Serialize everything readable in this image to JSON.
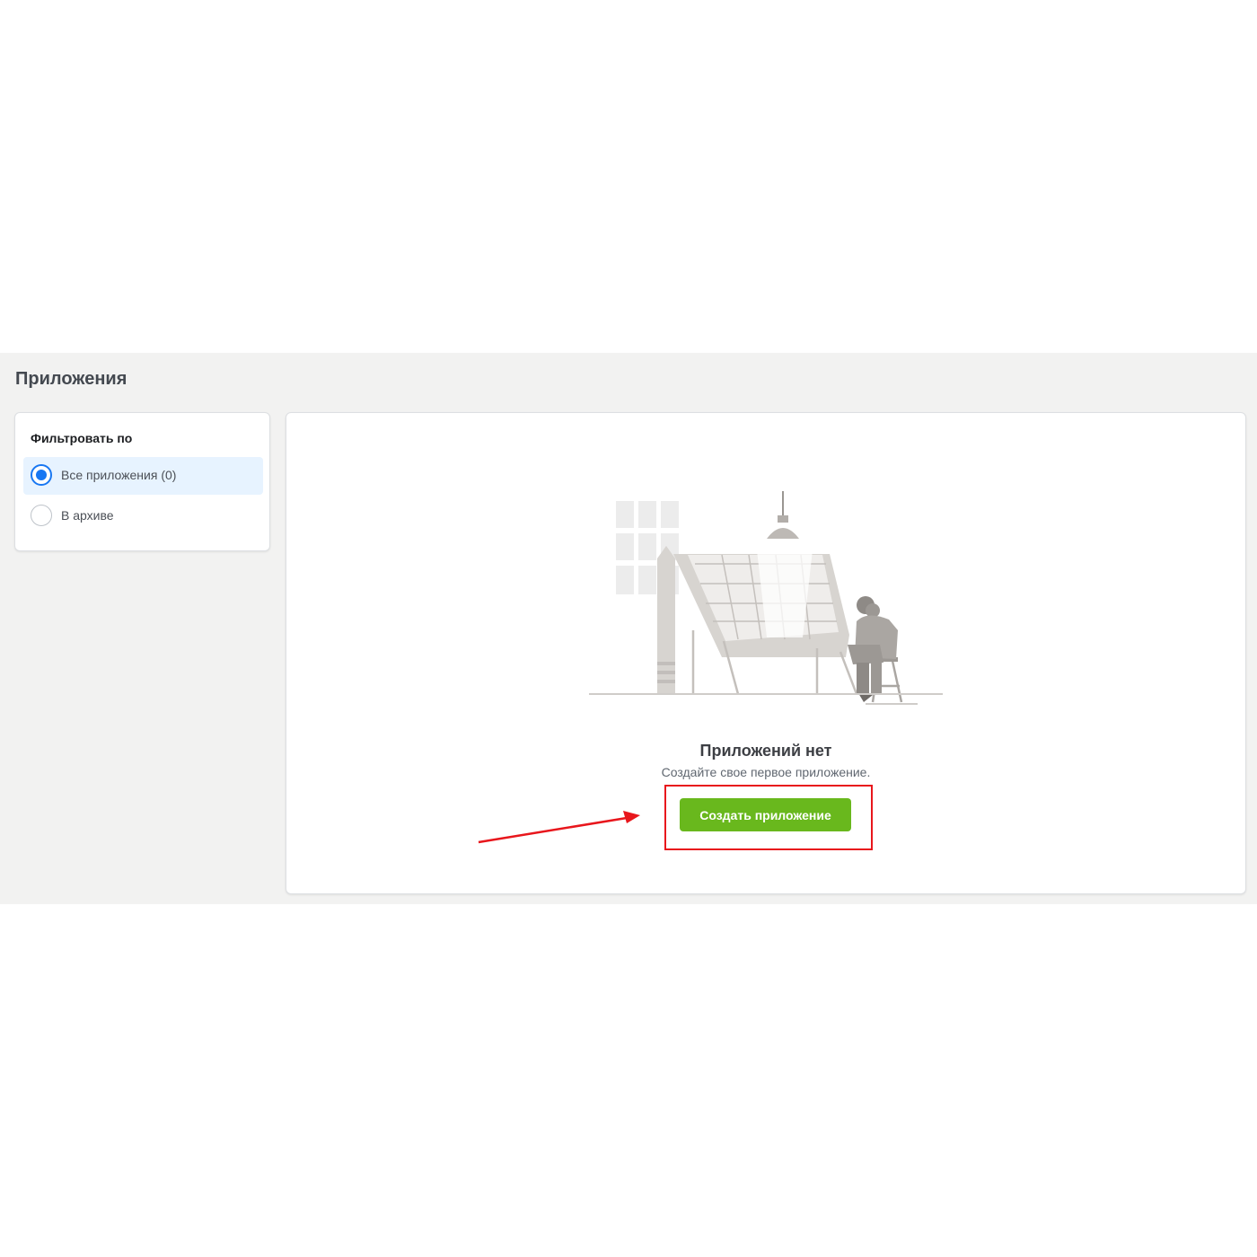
{
  "page": {
    "title": "Приложения"
  },
  "filter": {
    "heading": "Фильтровать по",
    "options": [
      {
        "label": "Все приложения (0)",
        "selected": true
      },
      {
        "label": "В архиве",
        "selected": false
      }
    ]
  },
  "empty_state": {
    "illustration": "person-at-drafting-table-illustration",
    "title": "Приложений нет",
    "subtitle": "Создайте свое первое приложение.",
    "button_label": "Создать приложение"
  },
  "annotation": {
    "color": "#e8161c",
    "arrow": "red-arrow-pointing-to-button",
    "highlight": "red-rectangle-around-button"
  },
  "colors": {
    "accent": "#1877f2",
    "button": "#69b81d",
    "background": "#f2f2f1"
  }
}
